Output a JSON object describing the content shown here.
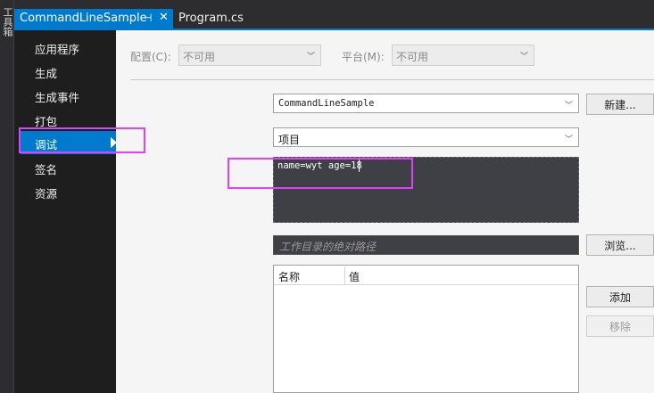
{
  "toolbox": {
    "label": "工具箱"
  },
  "tabs": {
    "active": {
      "label": "CommandLineSample",
      "pin_icon": "⊣",
      "close_icon": "✕"
    },
    "other": {
      "label": "Program.cs"
    }
  },
  "sidebar": {
    "items": [
      {
        "label": "应用程序"
      },
      {
        "label": "生成"
      },
      {
        "label": "生成事件"
      },
      {
        "label": "打包"
      },
      {
        "label": "调试"
      },
      {
        "label": "签名"
      },
      {
        "label": "资源"
      }
    ],
    "selected_index": 4
  },
  "config": {
    "config_label": "配置(C):",
    "config_value": "不可用",
    "platform_label": "平台(M):",
    "platform_value": "不可用"
  },
  "debug": {
    "profile_value": "CommandLineSample",
    "new_button": "新建...",
    "launch_value": "项目",
    "app_args": "name=wyt age=18",
    "workdir_placeholder": "工作目录的绝对路径",
    "browse_button": "浏览...",
    "env": {
      "col_name": "名称",
      "col_value": "值"
    },
    "add_button": "添加",
    "remove_button": "移除"
  },
  "colors": {
    "accent": "#007acc",
    "highlight": "#e040fb"
  }
}
